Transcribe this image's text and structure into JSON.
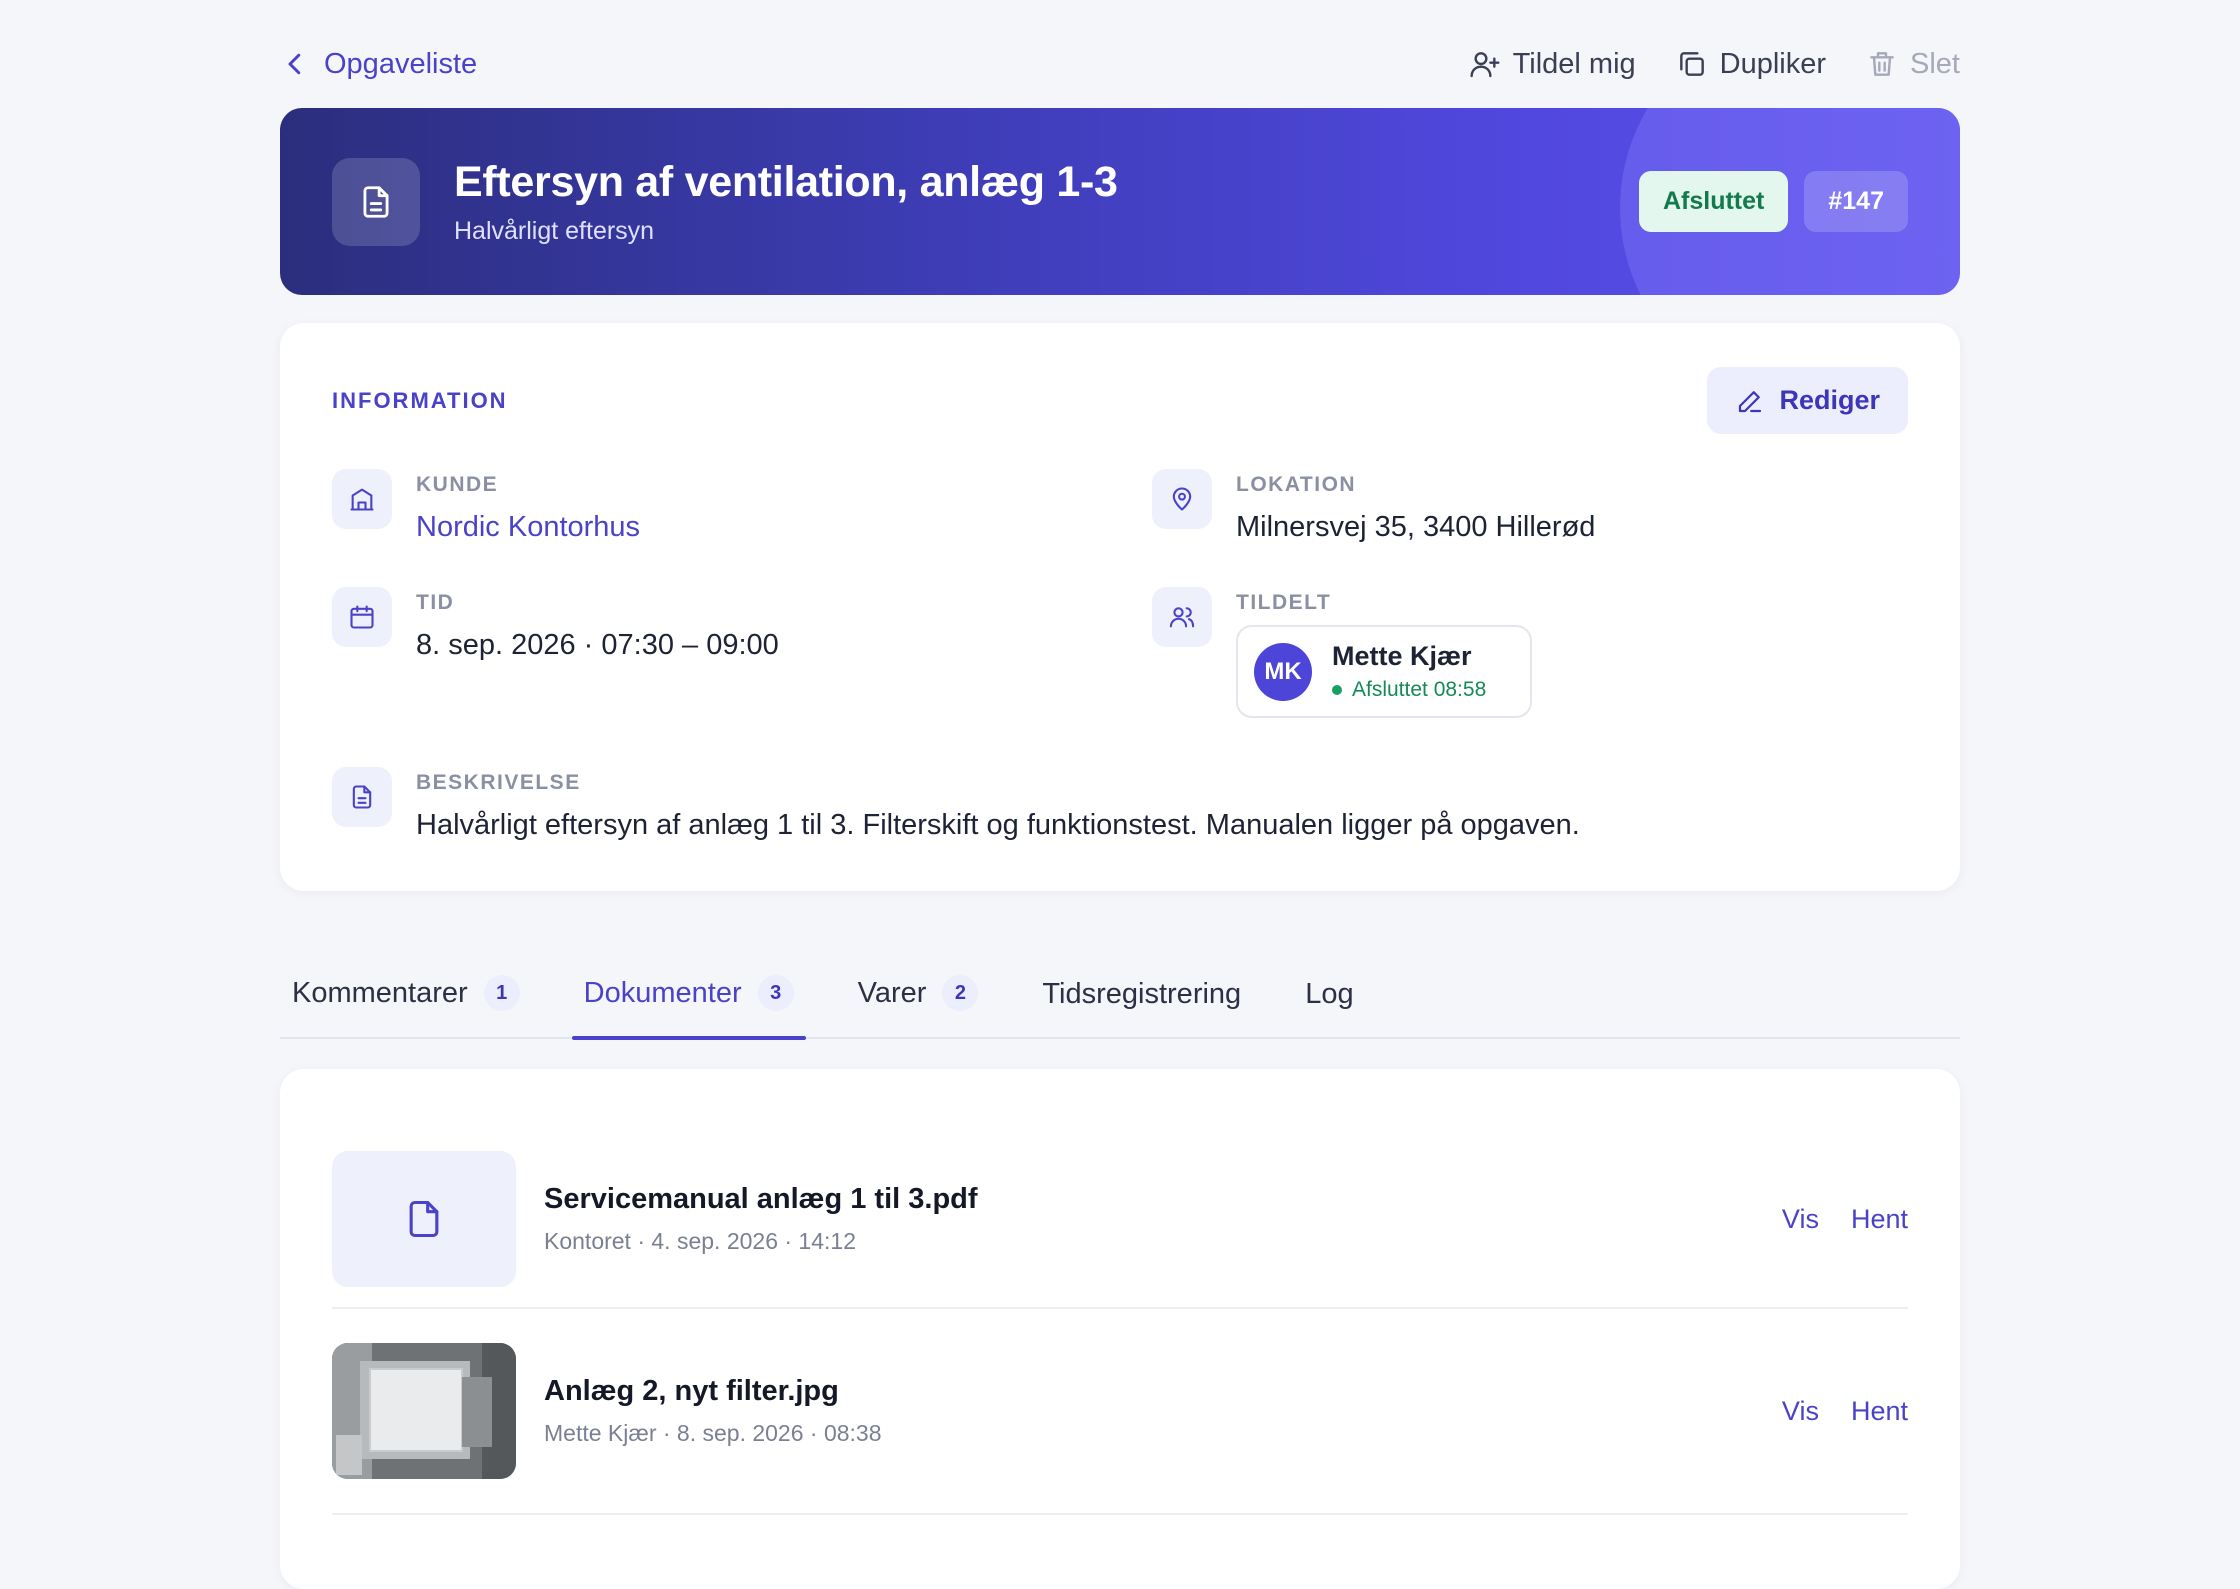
{
  "nav": {
    "back_label": "Opgaveliste",
    "actions": {
      "assign_me": "Tildel mig",
      "duplicate": "Dupliker",
      "delete": "Slet"
    }
  },
  "task": {
    "title": "Eftersyn af ventilation, anlæg 1-3",
    "subtitle": "Halvårligt eftersyn",
    "status": "Afsluttet",
    "number": "#147"
  },
  "info": {
    "section_label": "INFORMATION",
    "edit_label": "Rediger",
    "customer_label": "KUNDE",
    "customer_value": "Nordic Kontorhus",
    "location_label": "LOKATION",
    "location_value": "Milnersvej 35, 3400 Hillerød",
    "time_label": "TID",
    "time_value": "8. sep. 2026 · 07:30 – 09:00",
    "assigned_label": "TILDELT",
    "assignee": {
      "initials": "MK",
      "name": "Mette Kjær",
      "status": "Afsluttet 08:58"
    },
    "description_label": "BESKRIVELSE",
    "description_value": "Halvårligt eftersyn af anlæg 1 til 3. Filterskift og funktionstest. Manualen ligger på opgaven."
  },
  "tabs": [
    {
      "label": "Kommentarer",
      "count": "1"
    },
    {
      "label": "Dokumenter",
      "count": "3"
    },
    {
      "label": "Varer",
      "count": "2"
    },
    {
      "label": "Tidsregistrering"
    },
    {
      "label": "Log"
    }
  ],
  "documents": [
    {
      "name": "Servicemanual anlæg 1 til 3.pdf",
      "meta": "Kontoret · 4. sep. 2026 · 14:12",
      "thumb": "file-icon",
      "view": "Vis",
      "download": "Hent"
    },
    {
      "name": "Anlæg 2, nyt filter.jpg",
      "meta": "Mette Kjær · 8. sep. 2026 · 08:38",
      "thumb": "photo",
      "view": "Vis",
      "download": "Hent"
    }
  ],
  "colors": {
    "accent": "#4a43c9",
    "status_green": "#137a4e",
    "hero_start": "#2b2e7d",
    "hero_end": "#5c52ea"
  }
}
